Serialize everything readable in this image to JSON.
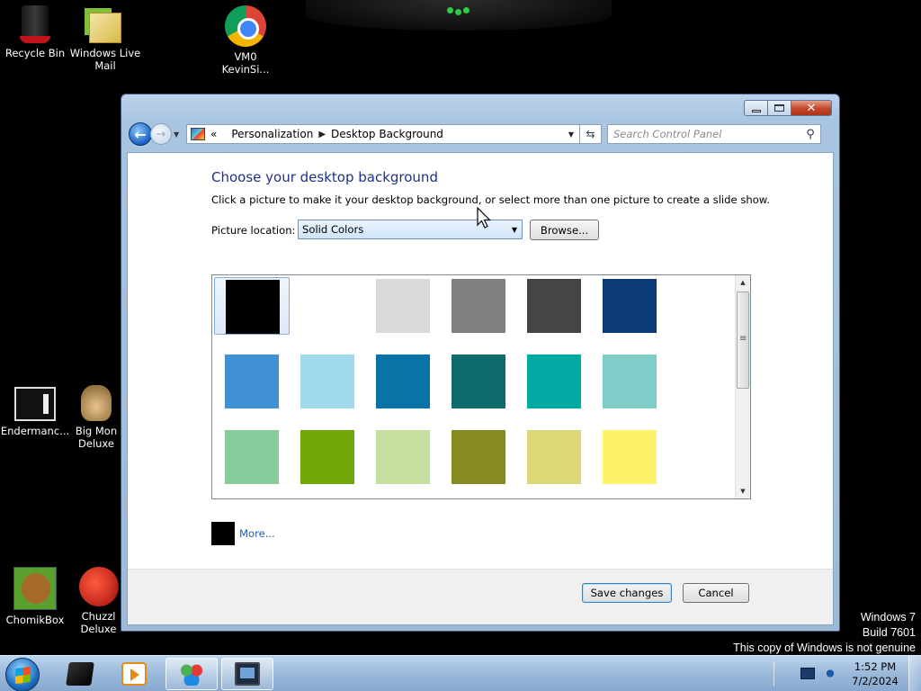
{
  "desktop": {
    "icons": [
      {
        "label": "Recycle Bin"
      },
      {
        "label": "Windows Live\nMail"
      },
      {
        "label": "VM0\nKevinSi..."
      },
      {
        "label": "Endermanc..."
      },
      {
        "label": "Big Mon\nDeluxe"
      },
      {
        "label": "ChomikBox"
      },
      {
        "label": "Chuzzl\nDeluxe"
      }
    ],
    "watermark": {
      "line1": "Windows 7",
      "line2": "Build 7601",
      "line3": "This copy of Windows is not genuine"
    }
  },
  "window": {
    "breadcrumb": {
      "overflow": "«",
      "items": [
        "Personalization",
        "Desktop Background"
      ]
    },
    "search": {
      "placeholder": "Search Control Panel"
    },
    "heading": "Choose your desktop background",
    "description": "Click a picture to make it your desktop background, or select more than one picture to create a slide show.",
    "picture_location": {
      "label": "Picture location:",
      "value": "Solid Colors",
      "browse_label": "Browse..."
    },
    "swatches": [
      "#000000",
      "#ffffff",
      "#d9d9d9",
      "#7f7f7f",
      "#454545",
      "#0b3a78",
      "#4192d4",
      "#9fd9eb",
      "#0a73a6",
      "#0d6b6c",
      "#00aaa2",
      "#7fcdc8",
      "#85cb9c",
      "#72a70a",
      "#c6df9e",
      "#858b20",
      "#dcd876",
      "#fdf36b"
    ],
    "selected_swatch": 0,
    "more": {
      "label": "More...",
      "color": "#000000"
    },
    "buttons": {
      "save": "Save changes",
      "cancel": "Cancel"
    }
  },
  "taskbar": {
    "clock": {
      "time": "1:52 PM",
      "date": "7/2/2024"
    }
  }
}
